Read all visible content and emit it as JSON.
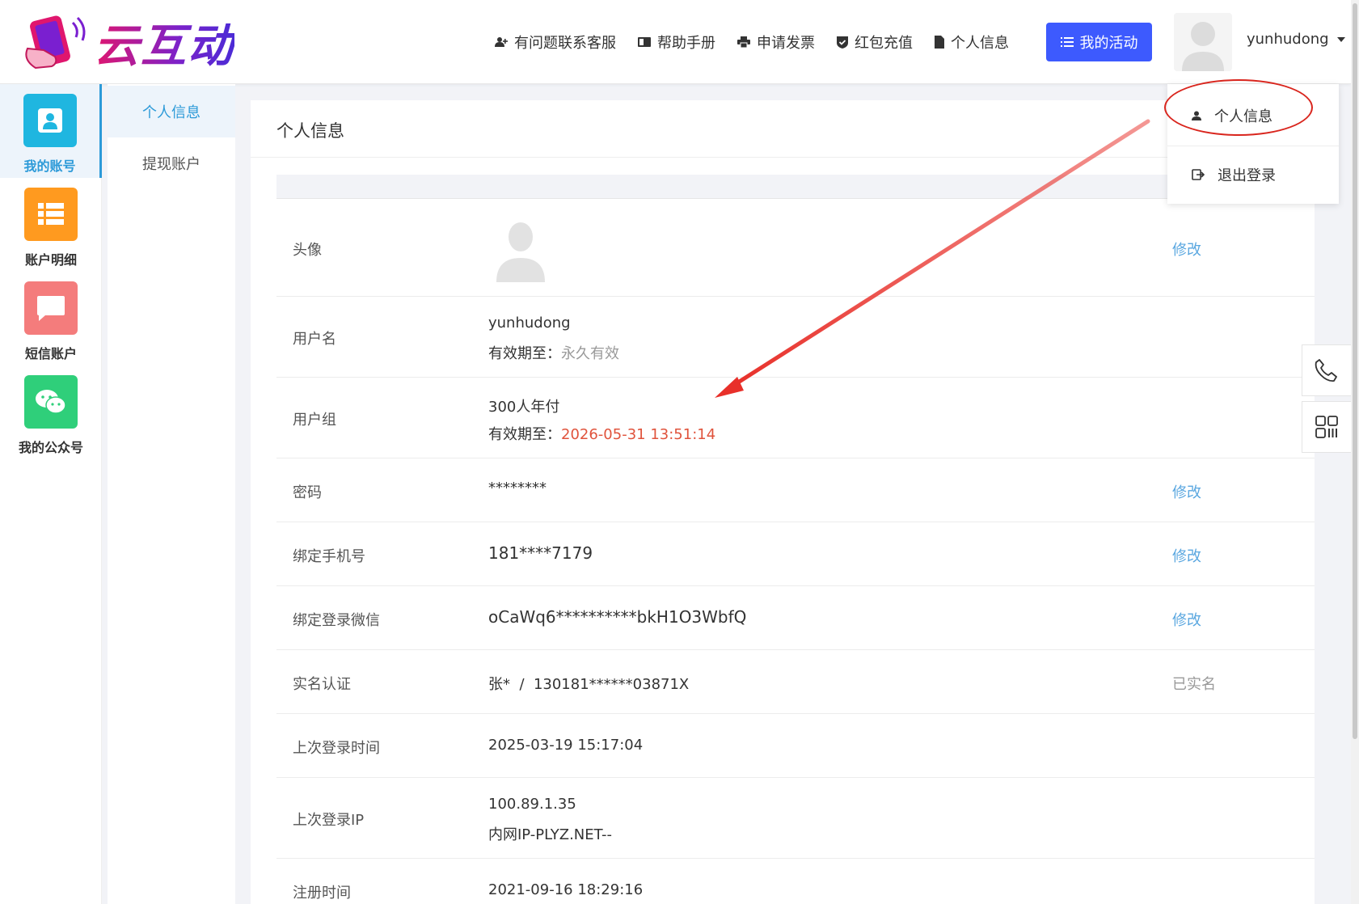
{
  "brand": {
    "logo_text": "云互动"
  },
  "topnav": {
    "items": [
      {
        "icon": "user-plus-icon",
        "label": "有问题联系客服"
      },
      {
        "icon": "book-icon",
        "label": "帮助手册"
      },
      {
        "icon": "printer-icon",
        "label": "申请发票"
      },
      {
        "icon": "shield-check-icon",
        "label": "红包充值"
      },
      {
        "icon": "file-icon",
        "label": "个人信息"
      }
    ],
    "activity_button": "我的活动",
    "username": "yunhudong"
  },
  "dropdown": {
    "items": [
      {
        "icon": "user-icon",
        "label": "个人信息"
      },
      {
        "icon": "logout-icon",
        "label": "退出登录"
      }
    ]
  },
  "iconbar": {
    "items": [
      {
        "label": "我的账号",
        "color": "#1fb6e0",
        "icon": "account-card-icon"
      },
      {
        "label": "账户明细",
        "color": "#ff9a1f",
        "icon": "list-icon"
      },
      {
        "label": "短信账户",
        "color": "#f47c7c",
        "icon": "message-icon"
      },
      {
        "label": "我的公众号",
        "color": "#2fcf7a",
        "icon": "wechat-icon"
      }
    ]
  },
  "subnav": {
    "items": [
      "个人信息",
      "提现账户"
    ]
  },
  "card": {
    "title": "个人信息",
    "rows": {
      "avatar": {
        "label": "头像",
        "action": "修改"
      },
      "username": {
        "label": "用户名",
        "value": "yunhudong",
        "expiry_prefix": "有效期至：",
        "expiry_value": "永久有效"
      },
      "usergroup": {
        "label": "用户组",
        "value": "300人年付",
        "expiry_prefix": "有效期至：",
        "expiry_value": "2026-05-31 13:51:14"
      },
      "password": {
        "label": "密码",
        "value": "********",
        "action": "修改"
      },
      "phone": {
        "label": "绑定手机号",
        "value": "181****7179",
        "action": "修改"
      },
      "wechat": {
        "label": "绑定登录微信",
        "value": "oCaWq6**********bkH1O3WbfQ",
        "action": "修改"
      },
      "realname": {
        "label": "实名认证",
        "value": "张*  /  130181******03871X",
        "status": "已实名"
      },
      "last_login_time": {
        "label": "上次登录时间",
        "value": "2025-03-19 15:17:04"
      },
      "last_login_ip": {
        "label": "上次登录IP",
        "value": "100.89.1.35",
        "value2": "内网IP-PLYZ.NET--"
      },
      "register_time": {
        "label": "注册时间",
        "value": "2021-09-16 18:29:16"
      }
    }
  },
  "colors": {
    "accent": "#3d5afe",
    "link": "#5aa7e0",
    "annotation": "#d9251d"
  }
}
